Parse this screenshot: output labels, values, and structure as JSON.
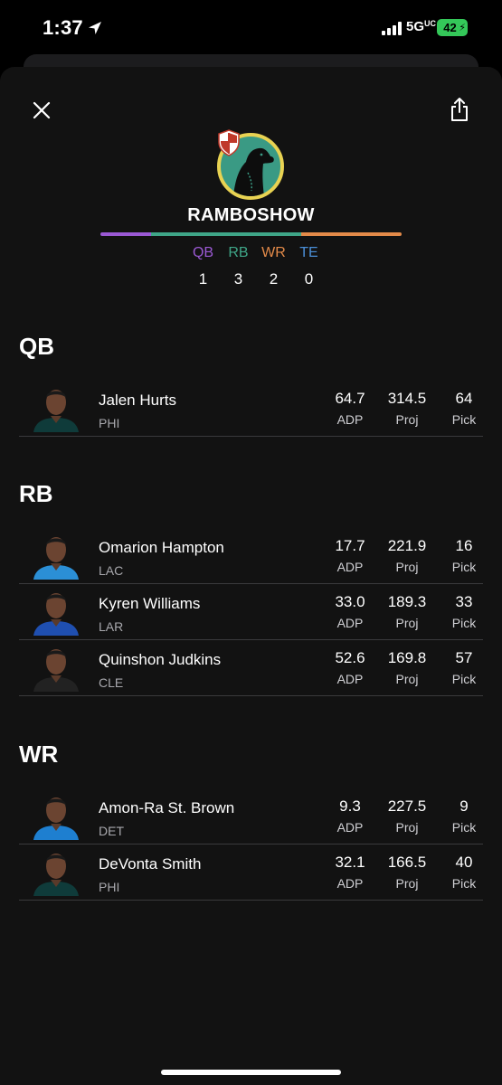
{
  "status_bar": {
    "time": "1:37",
    "network": "5G",
    "network_suffix": "UC",
    "battery": "42"
  },
  "header": {
    "close_icon": "close-icon",
    "share_icon": "share-icon",
    "team_name": "RAMBOSHOW",
    "avatar_icon": "dog-avatar-icon",
    "badge_icon": "shield-badge-icon"
  },
  "position_colors": {
    "QB": "#9b59d4",
    "RB": "#3fa688",
    "WR": "#e38a49",
    "TE": "#4a8fd8"
  },
  "position_counts": [
    {
      "label": "QB",
      "count": "1"
    },
    {
      "label": "RB",
      "count": "3"
    },
    {
      "label": "WR",
      "count": "2"
    },
    {
      "label": "TE",
      "count": "0"
    }
  ],
  "position_bar": [
    1,
    3,
    2,
    0
  ],
  "stat_labels": {
    "adp": "ADP",
    "proj": "Proj",
    "pick": "Pick"
  },
  "sections": [
    {
      "title": "QB",
      "players": [
        {
          "name": "Jalen Hurts",
          "team": "PHI",
          "adp": "64.7",
          "proj": "314.5",
          "pick": "64",
          "jersey": "#0f3b3a"
        }
      ]
    },
    {
      "title": "RB",
      "players": [
        {
          "name": "Omarion Hampton",
          "team": "LAC",
          "adp": "17.7",
          "proj": "221.9",
          "pick": "16",
          "jersey": "#2b8fd6"
        },
        {
          "name": "Kyren Williams",
          "team": "LAR",
          "adp": "33.0",
          "proj": "189.3",
          "pick": "33",
          "jersey": "#1f4fb0"
        },
        {
          "name": "Quinshon Judkins",
          "team": "CLE",
          "adp": "52.6",
          "proj": "169.8",
          "pick": "57",
          "jersey": "#222222"
        }
      ]
    },
    {
      "title": "WR",
      "players": [
        {
          "name": "Amon-Ra St. Brown",
          "team": "DET",
          "adp": "9.3",
          "proj": "227.5",
          "pick": "9",
          "jersey": "#1e7fd0"
        },
        {
          "name": "DeVonta Smith",
          "team": "PHI",
          "adp": "32.1",
          "proj": "166.5",
          "pick": "40",
          "jersey": "#0f3b3a"
        }
      ]
    }
  ]
}
